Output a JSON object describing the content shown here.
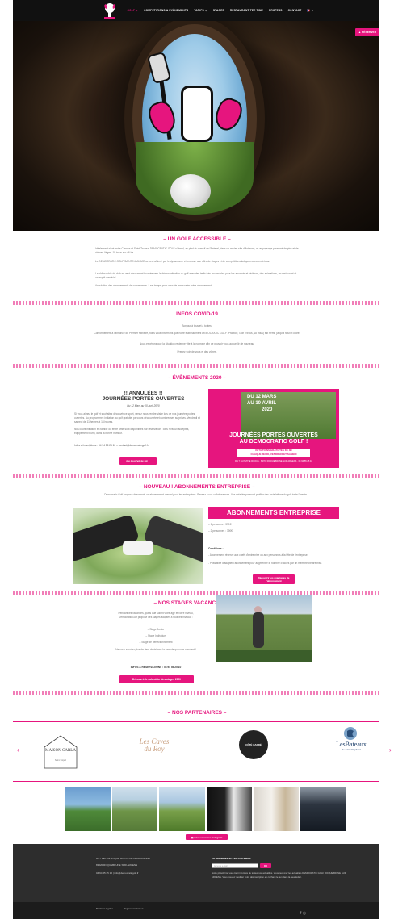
{
  "nav": {
    "items": [
      "GOLF ⌄",
      "COMPETITIONS & ÉVÈNEMENTS",
      "TARIFS ⌄",
      "STAGES",
      "RESTAURANT TEE TIME",
      "PROFESS",
      "CONTACT",
      "🇫🇷 ⌄"
    ],
    "reserve": "▲ RÉSERVER"
  },
  "golf": {
    "title": "– UN GOLF ACCESSIBLE –",
    "p1": "Idéalement situé entre Cannes et Saint-Tropez, DEMOCRATIC GOLF s'étend, au pied du massif de l'Esterel, dans un ancien site d'Ardenne, et un paysage parsemé de pins et de chênes-lièges. 18 trous sur 46 ha.",
    "p2": "Le DEMOCRATIC GOLF SAINTE-MAXIME se veut affirmé par le dynamisme et propose une offre de stages et de compétitions ludiques ouvertes à tous.",
    "p3": "La philosophie du club se veut résolument tournée vers la démocratisation du golf avec des tarifs très accessibles pour les abonnés et visiteurs, des animations, un restaurant et un esprit convivial.",
    "p4": "Annulation des abonnements de convenance. Il est temps pour vous de renouveler votre abonnement."
  },
  "covid": {
    "title": "INFOS COVID-19",
    "lines": [
      "Bonjour à tous et à toutes,",
      "Conformément à l'annonce du Premier Ministre, nous vous informons que notre établissement DEMOCRATIC GOLF (Practice, Golf 9 trous, 18 trous) est fermé jusqu'à nouvel ordre.",
      "Nous espérons que la situation revienne vite à la normale afin de pouvoir vous accueillir de nouveau.",
      "Prenez soin de vous et des vôtres."
    ]
  },
  "events": {
    "title": "– ÉVÈNEMENTS 2020 –",
    "cancel": "!! ANNULÉES !!",
    "jpo": "JOURNÉES PORTES OUVERTES",
    "dates": "Du 12 Mars au 10 Avril 2020",
    "p1": "Si vous aimez le golf et souhaitez découvrir ce sport, venez nous rendre visite lors de nos journées portes ouvertes. Au programme : initiation au golf gratuite, parcours découverte et nombreuses surprises. Vendredi et samedi de 11 heures à 14 heures.",
    "p2": "Nos cours initiation en famille ou entre amis sont disponibles sur réservation. Tous niveaux acceptés, équipement fourni, dans la bonne humeur.",
    "info": "Infos et inscriptions : 04 94 55 25 10 – contact@democraticgolf.fr",
    "button": "EN SAVOIR PLUS...",
    "poster_date1": "DU 12 MARS",
    "poster_date2": "AU 10 AVRIL",
    "poster_year": "2020",
    "poster_title1": "JOURNÉES PORTES OUVERTES",
    "poster_title2": "AU DEMOCRATIC GOLF !",
    "poster_sub1": "INITIATIONS GRATUITES DE 3H",
    "poster_sub2": "CHAQUE JEUDI, VENDREDI ET SAMEDI",
    "poster_foot": "RN 7 LA PETITE ROQUE · 83700 ROQUEBRUNE SUR ARGENS · 04 94 55 25 10"
  },
  "abo": {
    "title": "– NOUVEAU ! ABONNEMENTS ENTREPRISE –",
    "intro": "Democratic Golf propose désormais un abonnement annuel pour les entreprises. Pensez à vos collaborateurs. Vos salariés pourront profiter des installations du golf toute l'année.",
    "banner": "ABONNEMENTS ENTREPRISE",
    "l1": "– 1 personne : 390€",
    "l2": "– 2 personnes : 790€",
    "cond_title": "Conditions :",
    "cond1": "- Abonnement réservé aux chefs d'entreprise ou aux personnes à la tête de l'entreprise.",
    "cond2": "- Possibilité d'adapter l'abonnement pour augmenter le nombre d'accès par un membre d'entreprise.",
    "button": "Découvrir les avantages de l'abonnement"
  },
  "stages": {
    "title": "– NOS STAGES VACANCES 2020 –",
    "p1": "Pendant les vacances, quels que soient votre âge et votre niveau, Democratic Golf propose des stages adaptés à tous les niveaux :",
    "i1": "– Stage Junior",
    "i2": "– Stage Individuel",
    "i3": "– Stage de perfectionnement",
    "p2": "Ne vous souciez plus de rien, choisissez la formule qui vous convient !",
    "info": "INFOS & RÉSERVATIONS : 04 94 55 25 10",
    "button": "Découvrir le calendrier des stages 2020"
  },
  "partners": {
    "title": "– NOS PARTENAIRES –",
    "p1_main": "MAISON CARLA",
    "p1_sub": "Saint-Tropez",
    "p2": "Les Caves du Roy",
    "p3": "CÔTÉ CARRÉ",
    "p4_main": "LesBateaux",
    "p4_sub": "de Saint-Raphaël",
    "prev": "‹",
    "next": "›"
  },
  "gallery": {
    "button": "▣ suivez nous sur Instagram"
  },
  "footer": {
    "address1": "RN7 PETITE ROQUE ROUTE DE DRAGUIGNAN",
    "address2": "83520 ROQUEBRUNE SUR ARGENS",
    "phone": "04 94 55 25 10 | info@democraticgolf.fr",
    "nl_title": "VOTRE NEWSLETTER PAR EMAIL",
    "nl_placeholder": "Adresse e-mail",
    "nl_button": "OK",
    "nl_text": "Notre plateforme vous tient informés de toutes nos actualités. Vous recevrez les actualités DEMOCRATIC GOLF ROQUEBRUNE SUR ARGENS. Vous pouvez modifier votre désinscription en cochant le lien dans la newsletter.",
    "legal1": "Mentions légales",
    "legal2": "Réglement intérieur",
    "social": "f  ◎"
  }
}
